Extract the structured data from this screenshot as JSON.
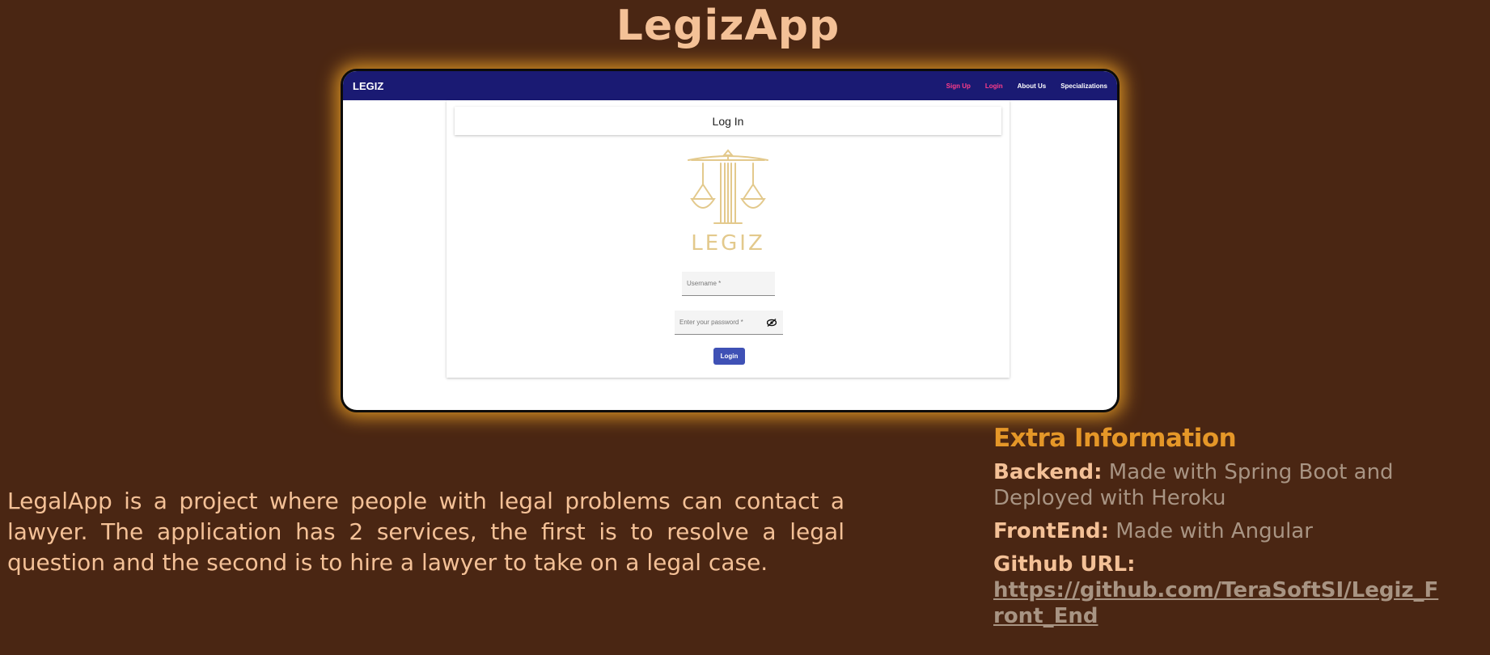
{
  "page_title": "LegizApp",
  "screenshot": {
    "brand": "LEGIZ",
    "nav": {
      "signup": "Sign Up",
      "login": "Login",
      "about": "About Us",
      "specializations": "Specializations"
    },
    "card_header": "Log In",
    "logo_text": "LEGIZ",
    "username_placeholder": "Username *",
    "password_placeholder": "Enter your password *",
    "login_button": "Login",
    "colors": {
      "nav_bg": "#1a1a73",
      "accent_link": "#ff3d8a",
      "button": "#3f51b5",
      "logo": "#e3c98c"
    }
  },
  "description": "LegalApp is a project where people with legal problems can contact a lawyer. The application has 2 services, the first is to resolve a legal question and the second is to hire a lawyer to take on a legal case.",
  "extra": {
    "title": "Extra Information",
    "backend_label": "Backend:",
    "backend_value": "Made with Spring Boot and Deployed with Heroku",
    "frontend_label": "FrontEnd:",
    "frontend_value": "Made with Angular",
    "github_label": "Github URL:",
    "github_url": "https://github.com/TeraSoftSI/Legiz_Front_End"
  },
  "colors": {
    "background": "#4a2613",
    "title": "#f4c197",
    "extra_title": "#e59728",
    "muted": "#a89483"
  }
}
